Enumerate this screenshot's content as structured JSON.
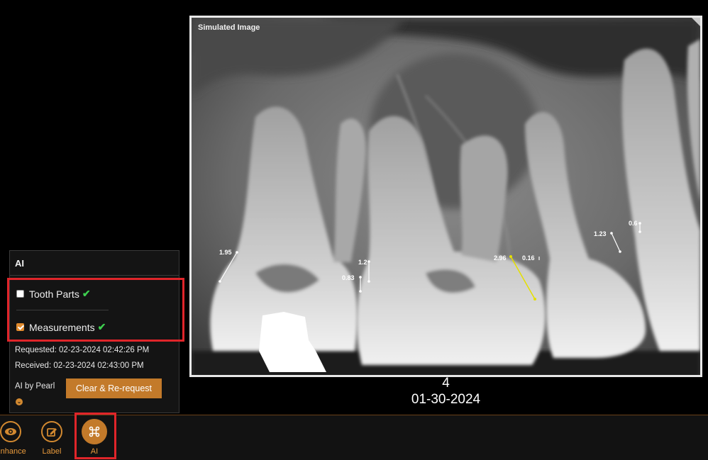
{
  "viewer": {
    "overlay_label": "Simulated Image",
    "image_number": "4",
    "image_date": "01-30-2024",
    "measurements": [
      {
        "label": "1.95",
        "highlight": false
      },
      {
        "label": "1.2",
        "highlight": false
      },
      {
        "label": "0.83",
        "highlight": false
      },
      {
        "label": "2.96",
        "highlight": true
      },
      {
        "label": "0.16",
        "highlight": false
      },
      {
        "label": "1.23",
        "highlight": false
      },
      {
        "label": "0.6",
        "highlight": false
      }
    ],
    "colors": {
      "measure": "#ffffff",
      "highlight": "#e5e000"
    }
  },
  "ai_panel": {
    "title": "AI",
    "options": [
      {
        "label": "Tooth Parts",
        "checked": false,
        "status_icon": "green-check-icon"
      },
      {
        "label": "Measurements",
        "checked": true,
        "status_icon": "green-check-icon"
      }
    ],
    "requested": "Requested: 02-23-2024 02:42:26 PM",
    "received": "Received: 02-23-2024 02:43:00 PM",
    "provider": "AI by Pearl",
    "rerequest_label": "Clear & Re-request",
    "expand_icon": "chevron-down-icon"
  },
  "toolbar": {
    "items": [
      {
        "label": "Enhance",
        "icon": "eye-icon",
        "active": false
      },
      {
        "label": "Label",
        "icon": "edit-icon",
        "active": false
      },
      {
        "label": "AI",
        "icon": "command-icon",
        "active": true
      }
    ],
    "accent": "#d28930"
  }
}
